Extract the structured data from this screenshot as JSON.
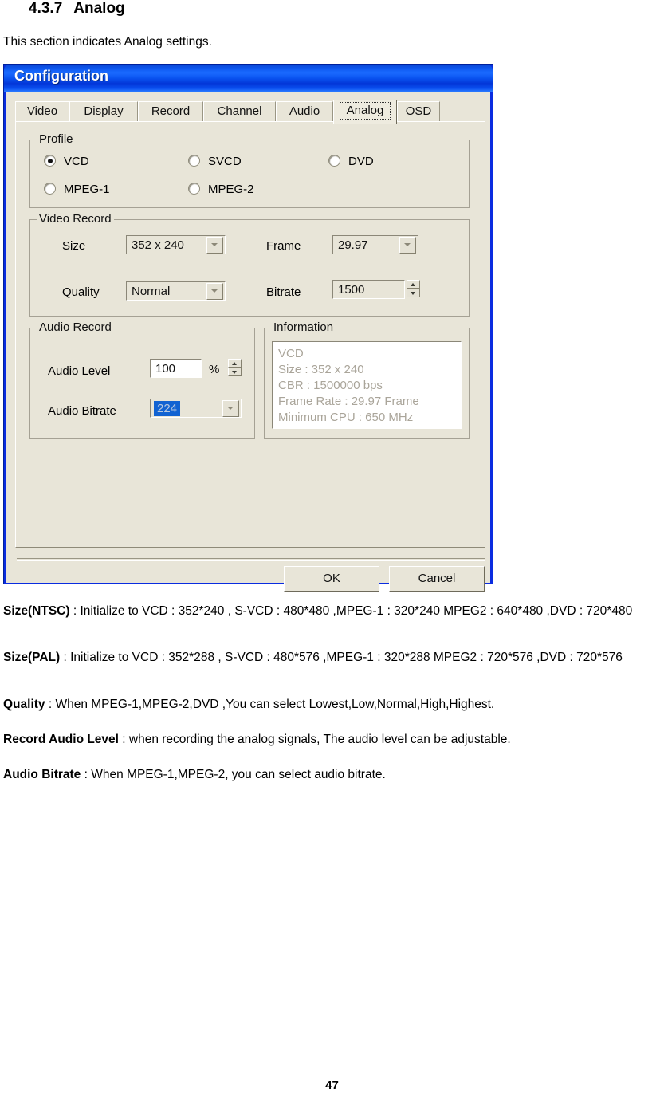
{
  "document": {
    "heading_number": "4.3.7",
    "heading_title": "Analog",
    "intro": "This section indicates Analog settings.",
    "page_number": "47",
    "paragraphs": [
      {
        "term": "Size(NTSC)",
        "body": " : Initialize to VCD : 352*240 , S-VCD : 480*480 ,MPEG-1 : 320*240 MPEG2 : 640*480 ,DVD : 720*480"
      },
      {
        "term": "Size(PAL)",
        "body": " : Initialize  to VCD : 352*288 , S-VCD : 480*576 ,MPEG-1 : 320*288 MPEG2 : 720*576 ,DVD : 720*576"
      },
      {
        "term": "Quality",
        "body": " : When MPEG-1,MPEG-2,DVD ,You can select Lowest,Low,Normal,High,Highest."
      },
      {
        "term": "Record Audio Level",
        "body": " : when recording the analog signals, The audio level can be adjustable."
      },
      {
        "term": "Audio Bitrate",
        "body": " : When MPEG-1,MPEG-2, you can select audio bitrate."
      }
    ]
  },
  "dialog": {
    "title": "Configuration",
    "title_bar_color": "#0a53f0",
    "client_color": "#e8e5d8",
    "tabs": [
      {
        "label": "Video",
        "active": false
      },
      {
        "label": "Display",
        "active": false
      },
      {
        "label": "Record",
        "active": false
      },
      {
        "label": "Channel",
        "active": false
      },
      {
        "label": "Audio",
        "active": false
      },
      {
        "label": "Analog",
        "active": true
      },
      {
        "label": "OSD",
        "active": false
      }
    ],
    "profile_group": {
      "legend": "Profile",
      "options": [
        {
          "label": "VCD",
          "checked": true
        },
        {
          "label": "SVCD",
          "checked": false
        },
        {
          "label": "DVD",
          "checked": false
        },
        {
          "label": "MPEG-1",
          "checked": false
        },
        {
          "label": "MPEG-2",
          "checked": false
        }
      ]
    },
    "video_record_group": {
      "legend": "Video Record",
      "size_label": "Size",
      "size_value": "352 x 240",
      "frame_label": "Frame",
      "frame_value": "29.97",
      "quality_label": "Quality",
      "quality_value": "Normal",
      "bitrate_label": "Bitrate",
      "bitrate_value": "1500"
    },
    "audio_record_group": {
      "legend": "Audio Record",
      "audio_level_label": "Audio Level",
      "audio_level_value": "100",
      "percent_symbol": "%",
      "audio_bitrate_label": "Audio Bitrate",
      "audio_bitrate_value": "224",
      "audio_bitrate_highlight_color": "#1263d2"
    },
    "information_group": {
      "legend": "Information",
      "lines": [
        "VCD",
        "Size : 352 x 240",
        "CBR : 1500000 bps",
        "Frame Rate : 29.97 Frame",
        "Minimum CPU : 650 MHz"
      ]
    },
    "buttons": {
      "ok": "OK",
      "cancel": "Cancel"
    }
  }
}
